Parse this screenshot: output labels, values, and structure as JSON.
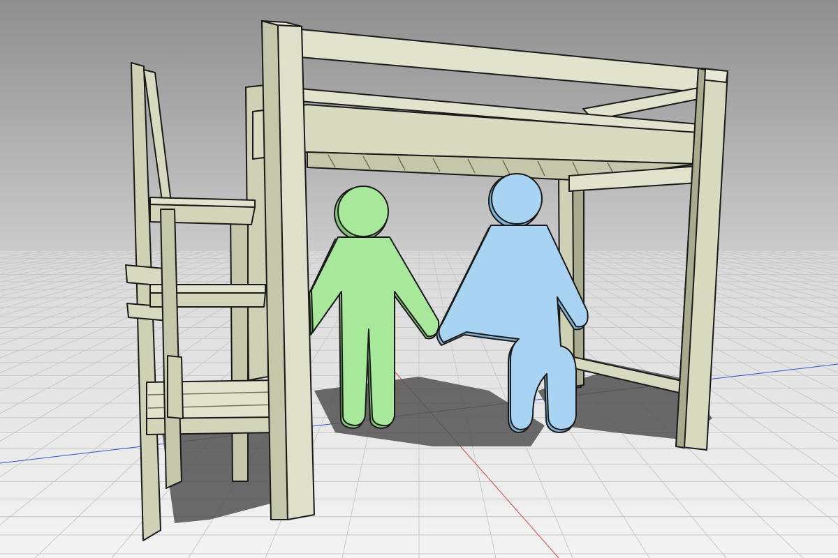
{
  "scene": {
    "subject": "3d-model-viewport",
    "objects": [
      "loft-bed-frame",
      "staircase-with-handrail",
      "standing-person-figure",
      "seated-person-figure"
    ]
  },
  "colors": {
    "sky_top": "#8e8e8e",
    "sky_bottom": "#d2d2d2",
    "ground": "#efefef",
    "grid_line": "#c9c9c9",
    "x_axis": "#d64545",
    "y_axis": "#3050d8",
    "wood_light": "#e2e3cc",
    "wood_mid": "#cfd1b4",
    "wood_dark": "#a9ab8e",
    "outline": "#1a1a1a",
    "shadow": "#525252",
    "figure_standing": "#a8e89a",
    "figure_standing_side": "#7fc772",
    "figure_seated": "#a8d3f2",
    "figure_seated_side": "#7fb2d8"
  }
}
